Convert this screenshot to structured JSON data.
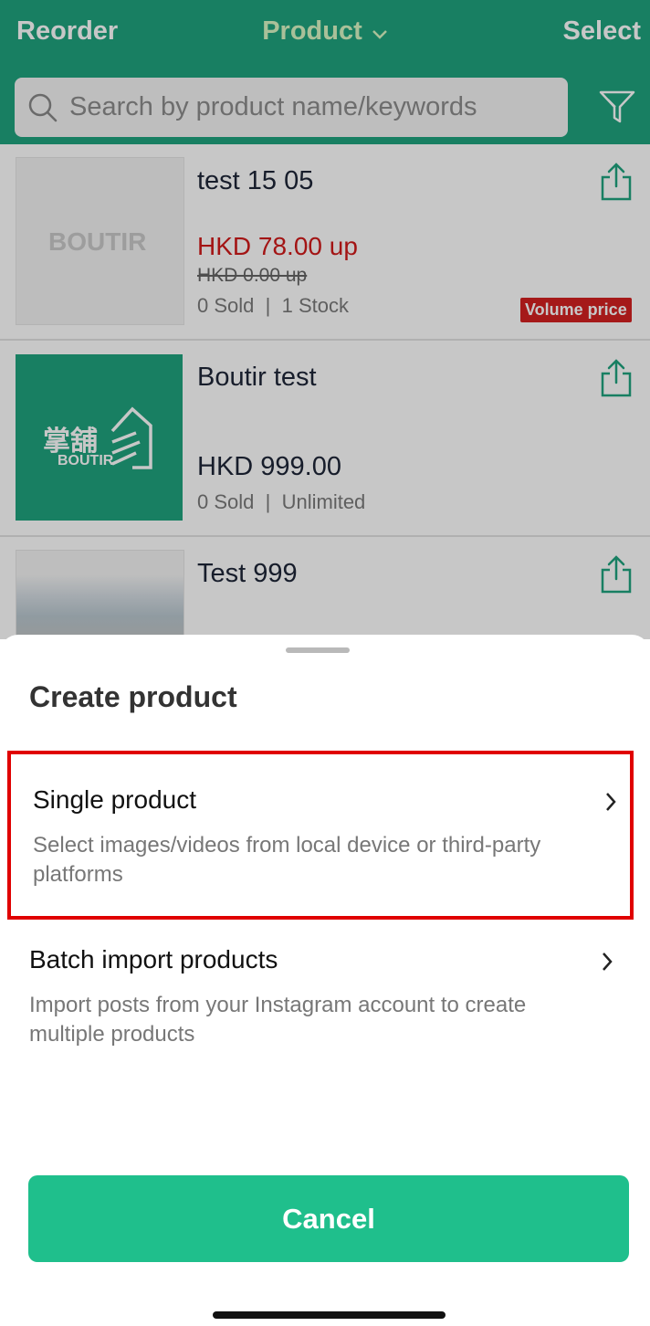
{
  "header": {
    "left_action": "Reorder",
    "title": "Product",
    "right_action": "Select"
  },
  "search": {
    "placeholder": "Search by product name/keywords"
  },
  "products": [
    {
      "name": "test 15 05",
      "price": "HKD 78.00 up",
      "original_price": "HKD 0.00 up",
      "sold": "0 Sold",
      "stock": "1 Stock",
      "badge": "Volume price",
      "thumb_logo": "BOUTIR"
    },
    {
      "name": "Boutir test",
      "price": "HKD 999.00",
      "sold": "0 Sold",
      "stock": "Unlimited",
      "thumb_logo_cn": "掌舖",
      "thumb_logo": "BOUTIR"
    },
    {
      "name": "Test 999"
    }
  ],
  "sheet": {
    "title": "Create product",
    "options": [
      {
        "title": "Single product",
        "description": "Select images/videos from local device or third-party platforms"
      },
      {
        "title": "Batch import products",
        "description": "Import posts from your Instagram account to create multiple products"
      }
    ],
    "cancel_label": "Cancel"
  },
  "colors": {
    "brand_green": "#1fa37e",
    "cancel_green": "#1fbf8c",
    "price_red": "#d11a1a",
    "highlight_red": "#e00000"
  }
}
